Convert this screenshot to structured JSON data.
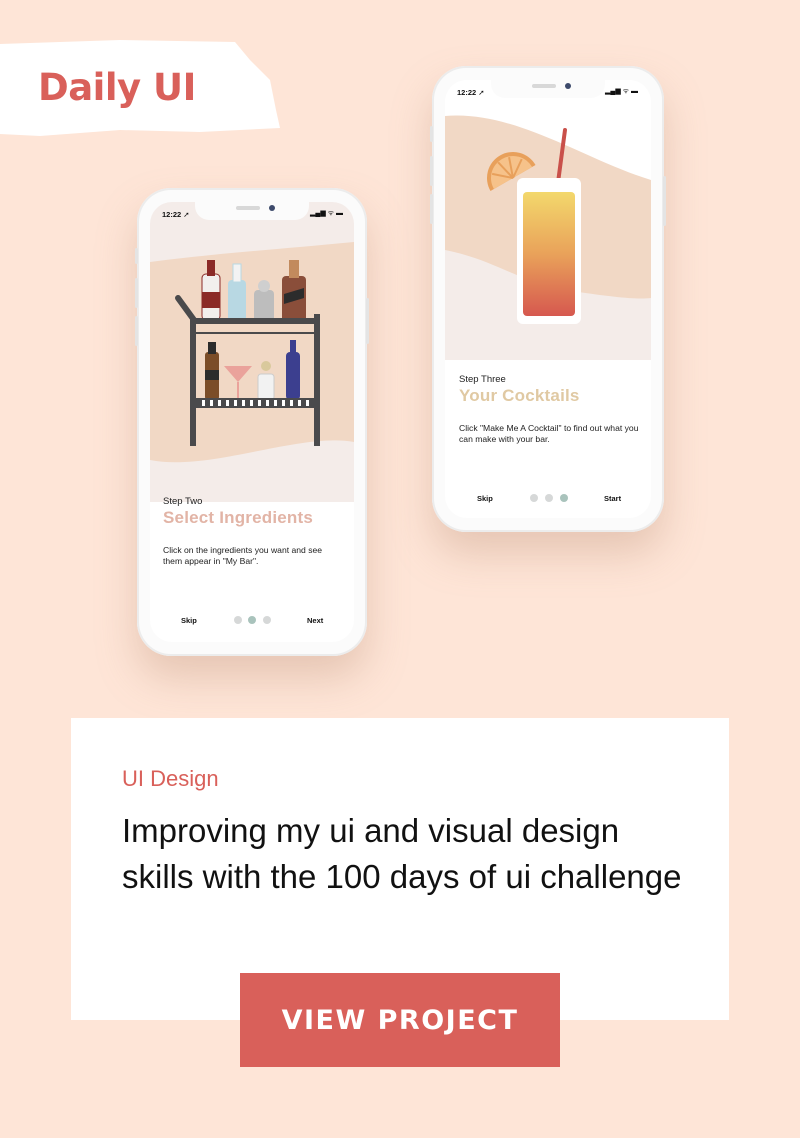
{
  "brand": {
    "label": "Daily UI",
    "color": "#d9605a"
  },
  "phone_left": {
    "status_time": "12:22 ➚",
    "status_icons": "▂▄▆ ᯤ ▬",
    "step_label": "Step Two",
    "step_title": "Select Ingredients",
    "title_color": "#e2b4a6",
    "description": "Click on the ingredients you want and see them appear in \"My Bar\".",
    "skip_label": "Skip",
    "next_label": "Next",
    "dots": [
      false,
      true,
      false
    ],
    "illustration": "bar-cart"
  },
  "phone_right": {
    "status_time": "12:22 ➚",
    "status_icons": "▂▄▆ ᯤ ▬",
    "step_label": "Step Three",
    "step_title": "Your Cocktails",
    "title_color": "#e0c9a3",
    "description": "Click \"Make Me A Cocktail\" to find out what you can make with your bar.",
    "skip_label": "Skip",
    "start_label": "Start",
    "dots": [
      false,
      false,
      true
    ],
    "illustration": "cocktail-glass"
  },
  "card": {
    "category": "UI Design",
    "title": "Improving my ui and visual design skills with the 100 days of ui challenge"
  },
  "cta": {
    "label": "VIEW PROJECT",
    "color": "#d9605a"
  }
}
